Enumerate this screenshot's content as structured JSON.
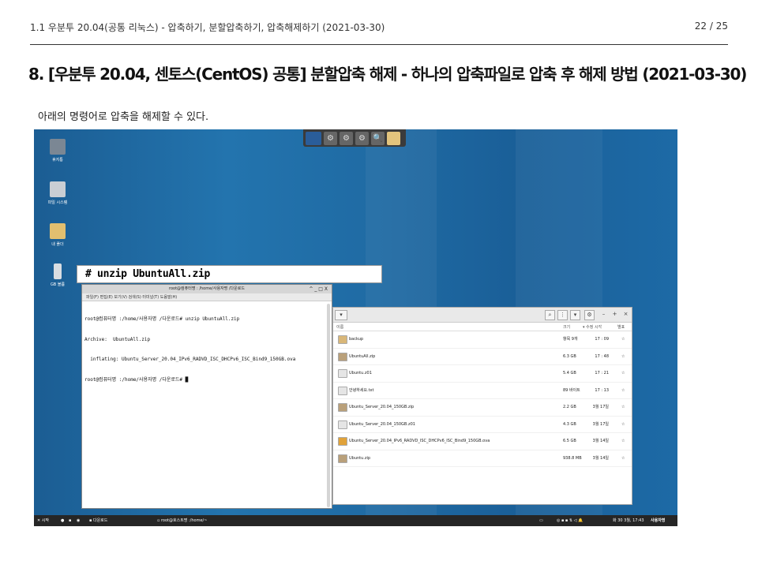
{
  "header": {
    "breadcrumb": "1.1 우분투 20.04(공통 리눅스) - 압축하기, 분할압축하기, 압축해제하기 (2021-03-30)",
    "page": "22 / 25"
  },
  "title": "8. [우분투 20.04, 센토스(CentOS) 공통] 분할압축 해제 - 하나의 압축파일로 압축 후 해제 방법 (2021-03-30)",
  "description": "아래의 명령어로 압축을 해제할 수 있다.",
  "desktop": {
    "icons": [
      {
        "label": "휴지통",
        "color": "#7b8794"
      },
      {
        "label": "파일 시스템",
        "color": "#c9ced4"
      },
      {
        "label": "내 폴더",
        "color": "#e2bf6f"
      },
      {
        "label": "GB 볼륨",
        "color": "#d8dde2"
      }
    ]
  },
  "command_box": "# unzip UbuntuAll.zip",
  "terminal": {
    "title": "root@컴퓨터명 : /home/사용자명 /다운로드",
    "controls": "^ _ □ X",
    "menu": "파일(F)   편집(E)   보기(V)   검색(S)   터미널(T)   도움말(H)",
    "lines": [
      "root@컴퓨터명 :/home/사용자명 /다운로드# unzip UbuntuAll.zip",
      "Archive:  UbuntuAll.zip",
      "  inflating: Ubuntu_Server_20.04_IPv6_RADVD_ISC_DHCPv6_ISC_Bind9_150GB.ova",
      "root@컴퓨터명 :/home/사용자명 /다운로드# █"
    ]
  },
  "file_manager": {
    "columns": {
      "name": "이름",
      "size": "크기",
      "modified": "▾ 수정 시각",
      "star": "별표"
    },
    "files": [
      {
        "name": "backup",
        "size": "항목 9개",
        "modified": "17 : 09",
        "star": "☆",
        "color": "#d9b778"
      },
      {
        "name": "UbuntuAll.zip",
        "size": "6.3 GB",
        "modified": "17 : 48",
        "star": "☆",
        "color": "#b9a07a"
      },
      {
        "name": "Ubuntu.z01",
        "size": "5.4 GB",
        "modified": "17 : 21",
        "star": "☆",
        "color": "#e5e5e5"
      },
      {
        "name": "안녕하세요.txt",
        "size": "89 바이트",
        "modified": "17 : 13",
        "star": "☆",
        "color": "#e5e5e5"
      },
      {
        "name": "Ubuntu_Server_20.04_150GB.zip",
        "size": "2.2 GB",
        "modified": "3월 17일",
        "star": "☆",
        "color": "#b9a07a"
      },
      {
        "name": "Ubuntu_Server_20.04_150GB.z01",
        "size": "4.3 GB",
        "modified": "3월 17일",
        "star": "☆",
        "color": "#e5e5e5"
      },
      {
        "name": "Ubuntu_Server_20.04_IPv6_RADVD_ISC_DHCPv6_ISC_Bind9_150GB.ova",
        "size": "6.5 GB",
        "modified": "3월 14일",
        "star": "☆",
        "color": "#e0a23a"
      },
      {
        "name": "Ubuntu.zip",
        "size": "938.8 MB",
        "modified": "3월 14일",
        "star": "☆",
        "color": "#b9a07a"
      }
    ]
  },
  "taskbar": {
    "start": "시작",
    "folder": "다운로드",
    "terminal_task": "root@호스트명 :/home/~",
    "clock": "화 30  3월, 17:43",
    "user": "사용자명"
  },
  "colors": {
    "desktop": "#1f6aa3",
    "taskbar": "#262626"
  }
}
